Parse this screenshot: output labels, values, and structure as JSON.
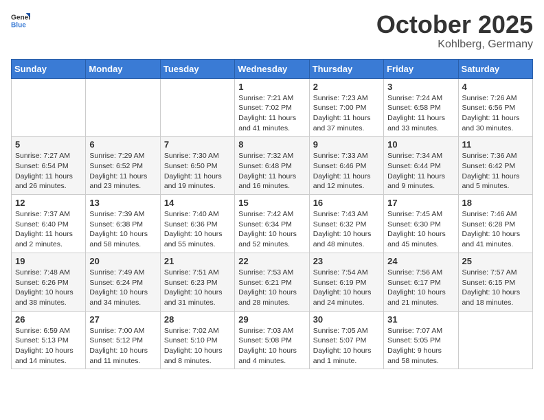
{
  "header": {
    "logo_general": "General",
    "logo_blue": "Blue",
    "month_title": "October 2025",
    "location": "Kohlberg, Germany"
  },
  "weekdays": [
    "Sunday",
    "Monday",
    "Tuesday",
    "Wednesday",
    "Thursday",
    "Friday",
    "Saturday"
  ],
  "weeks": [
    [
      {
        "day": "",
        "info": ""
      },
      {
        "day": "",
        "info": ""
      },
      {
        "day": "",
        "info": ""
      },
      {
        "day": "1",
        "info": "Sunrise: 7:21 AM\nSunset: 7:02 PM\nDaylight: 11 hours\nand 41 minutes."
      },
      {
        "day": "2",
        "info": "Sunrise: 7:23 AM\nSunset: 7:00 PM\nDaylight: 11 hours\nand 37 minutes."
      },
      {
        "day": "3",
        "info": "Sunrise: 7:24 AM\nSunset: 6:58 PM\nDaylight: 11 hours\nand 33 minutes."
      },
      {
        "day": "4",
        "info": "Sunrise: 7:26 AM\nSunset: 6:56 PM\nDaylight: 11 hours\nand 30 minutes."
      }
    ],
    [
      {
        "day": "5",
        "info": "Sunrise: 7:27 AM\nSunset: 6:54 PM\nDaylight: 11 hours\nand 26 minutes."
      },
      {
        "day": "6",
        "info": "Sunrise: 7:29 AM\nSunset: 6:52 PM\nDaylight: 11 hours\nand 23 minutes."
      },
      {
        "day": "7",
        "info": "Sunrise: 7:30 AM\nSunset: 6:50 PM\nDaylight: 11 hours\nand 19 minutes."
      },
      {
        "day": "8",
        "info": "Sunrise: 7:32 AM\nSunset: 6:48 PM\nDaylight: 11 hours\nand 16 minutes."
      },
      {
        "day": "9",
        "info": "Sunrise: 7:33 AM\nSunset: 6:46 PM\nDaylight: 11 hours\nand 12 minutes."
      },
      {
        "day": "10",
        "info": "Sunrise: 7:34 AM\nSunset: 6:44 PM\nDaylight: 11 hours\nand 9 minutes."
      },
      {
        "day": "11",
        "info": "Sunrise: 7:36 AM\nSunset: 6:42 PM\nDaylight: 11 hours\nand 5 minutes."
      }
    ],
    [
      {
        "day": "12",
        "info": "Sunrise: 7:37 AM\nSunset: 6:40 PM\nDaylight: 11 hours\nand 2 minutes."
      },
      {
        "day": "13",
        "info": "Sunrise: 7:39 AM\nSunset: 6:38 PM\nDaylight: 10 hours\nand 58 minutes."
      },
      {
        "day": "14",
        "info": "Sunrise: 7:40 AM\nSunset: 6:36 PM\nDaylight: 10 hours\nand 55 minutes."
      },
      {
        "day": "15",
        "info": "Sunrise: 7:42 AM\nSunset: 6:34 PM\nDaylight: 10 hours\nand 52 minutes."
      },
      {
        "day": "16",
        "info": "Sunrise: 7:43 AM\nSunset: 6:32 PM\nDaylight: 10 hours\nand 48 minutes."
      },
      {
        "day": "17",
        "info": "Sunrise: 7:45 AM\nSunset: 6:30 PM\nDaylight: 10 hours\nand 45 minutes."
      },
      {
        "day": "18",
        "info": "Sunrise: 7:46 AM\nSunset: 6:28 PM\nDaylight: 10 hours\nand 41 minutes."
      }
    ],
    [
      {
        "day": "19",
        "info": "Sunrise: 7:48 AM\nSunset: 6:26 PM\nDaylight: 10 hours\nand 38 minutes."
      },
      {
        "day": "20",
        "info": "Sunrise: 7:49 AM\nSunset: 6:24 PM\nDaylight: 10 hours\nand 34 minutes."
      },
      {
        "day": "21",
        "info": "Sunrise: 7:51 AM\nSunset: 6:23 PM\nDaylight: 10 hours\nand 31 minutes."
      },
      {
        "day": "22",
        "info": "Sunrise: 7:53 AM\nSunset: 6:21 PM\nDaylight: 10 hours\nand 28 minutes."
      },
      {
        "day": "23",
        "info": "Sunrise: 7:54 AM\nSunset: 6:19 PM\nDaylight: 10 hours\nand 24 minutes."
      },
      {
        "day": "24",
        "info": "Sunrise: 7:56 AM\nSunset: 6:17 PM\nDaylight: 10 hours\nand 21 minutes."
      },
      {
        "day": "25",
        "info": "Sunrise: 7:57 AM\nSunset: 6:15 PM\nDaylight: 10 hours\nand 18 minutes."
      }
    ],
    [
      {
        "day": "26",
        "info": "Sunrise: 6:59 AM\nSunset: 5:13 PM\nDaylight: 10 hours\nand 14 minutes."
      },
      {
        "day": "27",
        "info": "Sunrise: 7:00 AM\nSunset: 5:12 PM\nDaylight: 10 hours\nand 11 minutes."
      },
      {
        "day": "28",
        "info": "Sunrise: 7:02 AM\nSunset: 5:10 PM\nDaylight: 10 hours\nand 8 minutes."
      },
      {
        "day": "29",
        "info": "Sunrise: 7:03 AM\nSunset: 5:08 PM\nDaylight: 10 hours\nand 4 minutes."
      },
      {
        "day": "30",
        "info": "Sunrise: 7:05 AM\nSunset: 5:07 PM\nDaylight: 10 hours\nand 1 minute."
      },
      {
        "day": "31",
        "info": "Sunrise: 7:07 AM\nSunset: 5:05 PM\nDaylight: 9 hours\nand 58 minutes."
      },
      {
        "day": "",
        "info": ""
      }
    ]
  ]
}
